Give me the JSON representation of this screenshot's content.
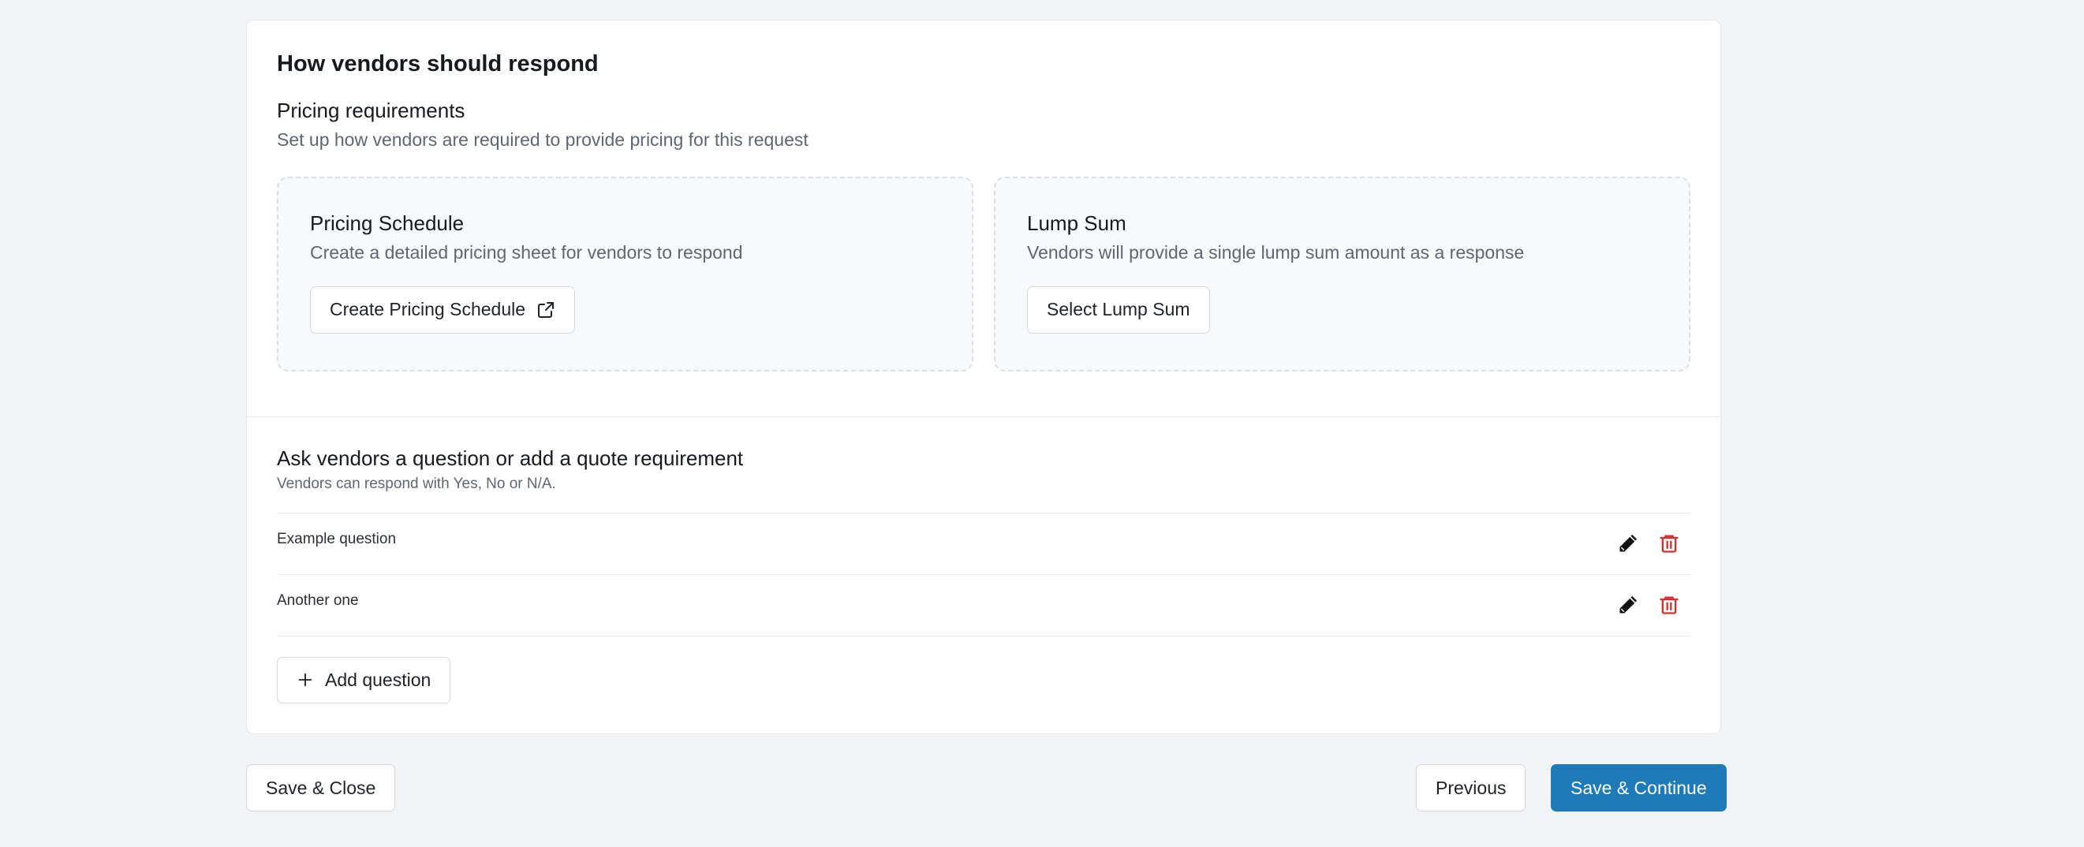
{
  "section": {
    "title": "How vendors should respond"
  },
  "pricing": {
    "title": "Pricing requirements",
    "description": "Set up how vendors are required to provide pricing for this request",
    "options": [
      {
        "title": "Pricing Schedule",
        "description": "Create a detailed pricing sheet for vendors to respond",
        "button_label": "Create Pricing Schedule",
        "button_icon": "external-link-icon"
      },
      {
        "title": "Lump Sum",
        "description": "Vendors will provide a single lump sum amount as a response",
        "button_label": "Select Lump Sum"
      }
    ]
  },
  "questions": {
    "title": "Ask vendors a question or add a quote requirement",
    "description": "Vendors can respond with Yes, No or N/A.",
    "items": [
      {
        "text": "Example question"
      },
      {
        "text": "Another one"
      }
    ],
    "edit_icon": "pencil-icon",
    "delete_icon": "trash-icon",
    "add_label": "Add question",
    "add_icon": "plus-icon"
  },
  "footer": {
    "save_close_label": "Save & Close",
    "previous_label": "Previous",
    "save_continue_label": "Save & Continue"
  },
  "colors": {
    "page_background": "#f2f3f5",
    "primary": "#1f7bb8",
    "danger": "#d32f2f",
    "muted_text": "#5f6670"
  }
}
